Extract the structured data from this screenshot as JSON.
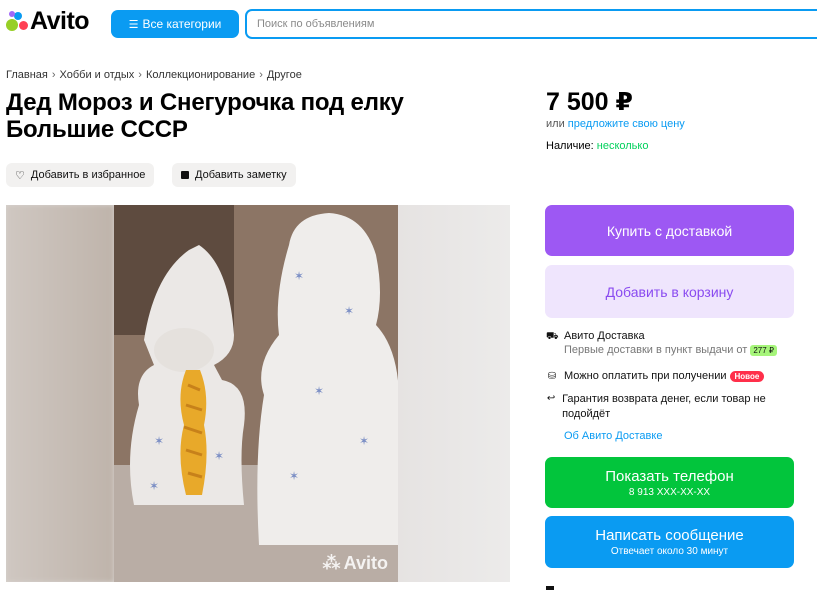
{
  "header": {
    "logo_text": "Avito",
    "categories_label": "Все категории",
    "search_placeholder": "Поиск по объявлениям",
    "accent": "#0a9bf2"
  },
  "breadcrumb": [
    "Главная",
    "Хобби и отдых",
    "Коллекционирование",
    "Другое"
  ],
  "item": {
    "title": "Дед Мороз и Снегурочка под елку Большие СССР",
    "favorite_label": "Добавить в избранное",
    "note_label": "Добавить заметку",
    "photo_watermark": "Avito"
  },
  "sidebar": {
    "price": "7 500 ₽",
    "offer_prefix": "или",
    "offer_link": "предложите свою цену",
    "stock_label": "Наличие:",
    "stock_value": "несколько",
    "buy_label": "Купить с доставкой",
    "cart_label": "Добавить в корзину",
    "delivery_title": "Авито Доставка",
    "delivery_sub": "Первые доставки в пункт выдачи от",
    "delivery_price": "277 ₽",
    "pay_on_receipt": "Можно оплатить при получении",
    "new_badge": "Новое",
    "guarantee": "Гарантия возврата денег, если товар не подойдёт",
    "about_delivery": "Об Авито Доставке",
    "phone_label": "Показать телефон",
    "phone_number": "8 913 XXX-XX-XX",
    "message_label": "Написать сообщение",
    "message_sub": "Отвечает около 30 минут"
  },
  "colors": {
    "buy": "#9d58f3",
    "cart_bg": "#efe5fd",
    "phone": "#02c53c",
    "message": "#0a9bf2",
    "stock_ok": "#02d15c"
  }
}
